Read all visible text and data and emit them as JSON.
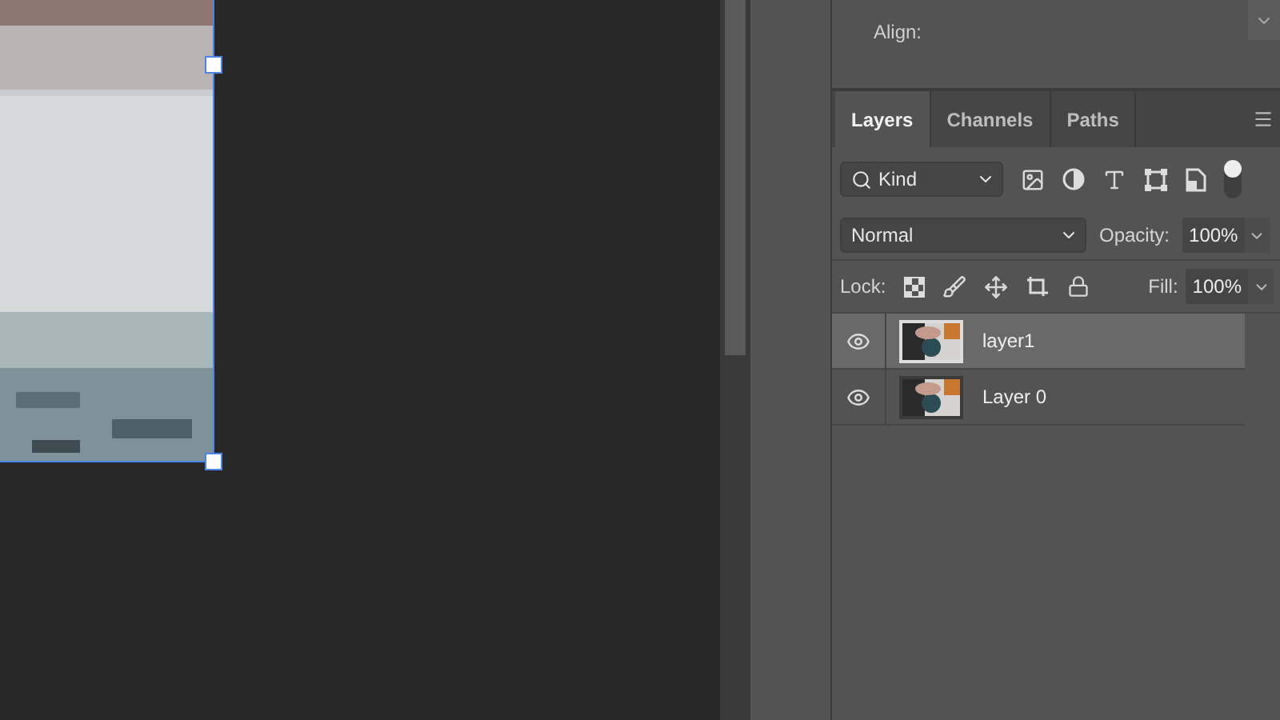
{
  "properties": {
    "align_label": "Align:"
  },
  "layers_panel": {
    "tabs": [
      {
        "label": "Layers",
        "selected": true
      },
      {
        "label": "Channels",
        "selected": false
      },
      {
        "label": "Paths",
        "selected": false
      }
    ],
    "filter": {
      "value": "Kind",
      "enabled": true
    },
    "blend_mode": {
      "value": "Normal"
    },
    "opacity": {
      "label": "Opacity:",
      "value": "100%"
    },
    "lock": {
      "label": "Lock:"
    },
    "fill": {
      "label": "Fill:",
      "value": "100%"
    },
    "layers": [
      {
        "name": "layer1",
        "selected": true,
        "visible": true
      },
      {
        "name": "Layer 0",
        "selected": false,
        "visible": true
      }
    ]
  }
}
